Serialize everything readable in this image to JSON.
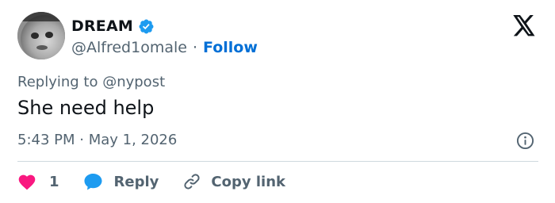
{
  "author": {
    "display_name": "DREAM",
    "handle": "@Alfred1omale",
    "separator": "·",
    "follow_label": "Follow",
    "verified": true
  },
  "tweet": {
    "replying_to": "Replying to @nypost",
    "text": "She need help",
    "timestamp": "5:43 PM · May 1, 2026"
  },
  "actions": {
    "like_count": "1",
    "reply_label": "Reply",
    "copy_link_label": "Copy link"
  },
  "icons": {
    "brand": "x-logo-icon",
    "verified": "verified-badge-icon",
    "info": "info-icon",
    "like": "heart-icon",
    "reply": "reply-bubble-icon",
    "copy": "link-icon"
  },
  "colors": {
    "text": "#0f1419",
    "secondary": "#536471",
    "accent": "#006fd6",
    "verified": "#1d9bf0",
    "like": "#f91880",
    "divider": "#cfd9de"
  }
}
